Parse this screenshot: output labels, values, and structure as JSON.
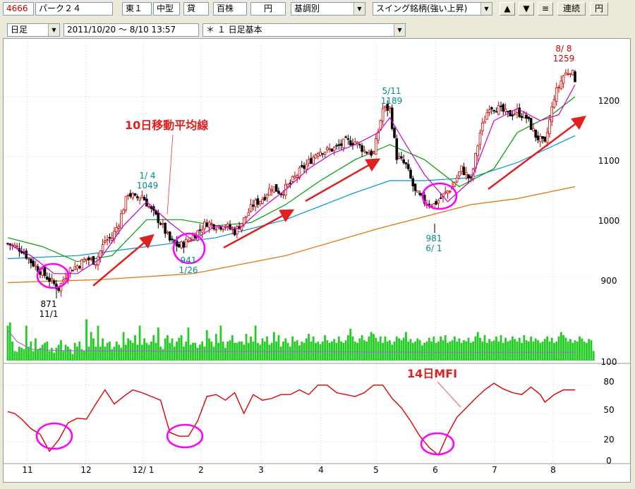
{
  "toolbar1": {
    "code": "4666",
    "name": "パーク２４",
    "market": "東１",
    "size": "中型",
    "lending": "貸",
    "unit": "百株",
    "currency_btn": "円",
    "select_mode": "基調別",
    "select_screen": "スイング銘柄(強い上昇)",
    "up_btn": "▲",
    "down_btn": "▼",
    "menu_btn": "≡",
    "continuous_btn": "連続",
    "yen_btn": "円"
  },
  "toolbar2": {
    "period": "日足",
    "range": "2011/10/20 ～  8/10 13:57",
    "template": "＊ １ 日足基本"
  },
  "chart_data": [
    {
      "type": "candlestick",
      "title": "",
      "price_axis": {
        "ticks": [
          900,
          1000,
          1100,
          1200
        ],
        "range": [
          870,
          1265
        ]
      },
      "x_months": [
        "11",
        "12",
        "12/ 1",
        "2",
        "3",
        "4",
        "5",
        "6",
        "7",
        "8"
      ],
      "annotations": [
        {
          "label_date": "1/ 4",
          "label_value": "1049"
        },
        {
          "label_date": "1/26",
          "label_value": "941"
        },
        {
          "label_date": "5/11",
          "label_value": "1189"
        },
        {
          "label_date": "6/ 1",
          "label_value": "981"
        },
        {
          "label_date": "8/ 8",
          "label_value": "1259"
        },
        {
          "label_date": "11/1",
          "label_value": "871"
        },
        {
          "text": "10日移動平均線"
        }
      ],
      "close_path": [
        [
          0,
          955
        ],
        [
          6,
          945
        ],
        [
          10,
          925
        ],
        [
          14,
          910
        ],
        [
          18,
          895
        ],
        [
          22,
          880
        ],
        [
          26,
          910
        ],
        [
          30,
          918
        ],
        [
          34,
          930
        ],
        [
          38,
          925
        ],
        [
          42,
          960
        ],
        [
          45,
          965
        ],
        [
          48,
          990
        ],
        [
          52,
          1040
        ],
        [
          55,
          1030
        ],
        [
          58,
          1035
        ],
        [
          62,
          1010
        ],
        [
          66,
          990
        ],
        [
          70,
          960
        ],
        [
          74,
          950
        ],
        [
          78,
          960
        ],
        [
          82,
          975
        ],
        [
          86,
          990
        ],
        [
          90,
          985
        ],
        [
          94,
          985
        ],
        [
          98,
          975
        ],
        [
          102,
          995
        ],
        [
          106,
          1020
        ],
        [
          110,
          1030
        ],
        [
          114,
          1050
        ],
        [
          118,
          1040
        ],
        [
          122,
          1055
        ],
        [
          126,
          1075
        ],
        [
          130,
          1090
        ],
        [
          134,
          1110
        ],
        [
          138,
          1110
        ],
        [
          142,
          1115
        ],
        [
          146,
          1125
        ],
        [
          150,
          1125
        ],
        [
          154,
          1110
        ],
        [
          158,
          1105
        ],
        [
          162,
          1180
        ],
        [
          165,
          1180
        ],
        [
          168,
          1100
        ],
        [
          172,
          1085
        ],
        [
          176,
          1040
        ],
        [
          180,
          1025
        ],
        [
          184,
          1020
        ],
        [
          188,
          1035
        ],
        [
          192,
          1050
        ],
        [
          196,
          1080
        ],
        [
          200,
          1060
        ],
        [
          204,
          1140
        ],
        [
          208,
          1185
        ],
        [
          212,
          1180
        ],
        [
          216,
          1170
        ],
        [
          220,
          1175
        ],
        [
          224,
          1165
        ],
        [
          228,
          1135
        ],
        [
          232,
          1120
        ],
        [
          236,
          1200
        ],
        [
          240,
          1235
        ],
        [
          243,
          1245
        ],
        [
          245,
          1230
        ]
      ],
      "ma10_path": [
        [
          0,
          955
        ],
        [
          10,
          935
        ],
        [
          20,
          905
        ],
        [
          30,
          905
        ],
        [
          40,
          930
        ],
        [
          50,
          985
        ],
        [
          60,
          1025
        ],
        [
          70,
          990
        ],
        [
          80,
          960
        ],
        [
          90,
          985
        ],
        [
          100,
          980
        ],
        [
          110,
          1015
        ],
        [
          120,
          1045
        ],
        [
          130,
          1080
        ],
        [
          140,
          1105
        ],
        [
          150,
          1120
        ],
        [
          160,
          1140
        ],
        [
          165,
          1165
        ],
        [
          172,
          1120
        ],
        [
          180,
          1070
        ],
        [
          190,
          1025
        ],
        [
          200,
          1060
        ],
        [
          210,
          1160
        ],
        [
          220,
          1180
        ],
        [
          230,
          1160
        ],
        [
          238,
          1170
        ],
        [
          245,
          1220
        ]
      ],
      "ma25_path": [
        [
          0,
          965
        ],
        [
          15,
          950
        ],
        [
          30,
          925
        ],
        [
          45,
          935
        ],
        [
          60,
          995
        ],
        [
          75,
          995
        ],
        [
          90,
          985
        ],
        [
          105,
          990
        ],
        [
          120,
          1020
        ],
        [
          135,
          1060
        ],
        [
          150,
          1095
        ],
        [
          165,
          1120
        ],
        [
          180,
          1095
        ],
        [
          195,
          1050
        ],
        [
          210,
          1080
        ],
        [
          220,
          1140
        ],
        [
          235,
          1170
        ],
        [
          245,
          1200
        ]
      ],
      "ma75_path": [
        [
          0,
          930
        ],
        [
          30,
          935
        ],
        [
          60,
          950
        ],
        [
          90,
          965
        ],
        [
          120,
          995
        ],
        [
          150,
          1040
        ],
        [
          165,
          1060
        ],
        [
          180,
          1060
        ],
        [
          200,
          1065
        ],
        [
          220,
          1090
        ],
        [
          245,
          1135
        ]
      ],
      "ma200_path": [
        [
          0,
          890
        ],
        [
          40,
          895
        ],
        [
          80,
          905
        ],
        [
          120,
          935
        ],
        [
          160,
          980
        ],
        [
          200,
          1020
        ],
        [
          220,
          1030
        ],
        [
          245,
          1050
        ]
      ]
    },
    {
      "type": "bar",
      "title": "",
      "ylabel_tick": "100",
      "values": [
        55,
        60,
        30,
        15,
        14,
        22,
        20,
        18,
        55,
        22,
        30,
        15,
        35,
        18,
        20,
        25,
        28,
        30,
        15,
        20,
        12,
        20,
        25,
        32,
        15,
        25,
        22,
        18,
        10,
        28,
        22,
        30,
        18,
        16,
        65,
        22,
        45,
        35,
        22,
        55,
        22,
        35,
        22,
        28,
        30,
        18,
        22,
        30,
        25,
        20,
        45,
        25,
        35,
        32,
        28,
        40,
        25,
        55,
        25,
        35,
        28,
        25,
        30,
        40,
        28,
        52,
        22,
        18,
        35,
        40,
        28,
        35,
        22,
        30,
        36,
        40,
        22,
        30,
        52,
        25,
        28,
        28,
        20,
        25,
        30,
        22,
        48,
        35,
        30,
        22,
        42,
        28,
        55,
        30,
        20,
        30,
        32,
        40,
        28,
        28,
        30,
        30,
        25,
        42,
        28,
        38,
        30,
        55,
        28,
        25,
        35,
        30,
        38,
        25,
        28,
        45,
        30,
        40,
        22,
        30,
        35,
        28,
        22,
        38,
        30,
        32,
        24,
        30,
        28,
        35,
        42,
        30,
        38,
        28,
        30,
        26,
        30,
        40,
        32,
        28,
        30,
        34,
        28,
        38,
        30,
        28,
        32,
        40,
        50,
        38,
        30,
        28,
        35,
        40,
        32,
        30,
        38,
        45,
        42,
        36,
        30,
        38,
        28,
        38,
        30,
        32,
        25,
        30,
        38,
        35,
        32,
        36,
        45,
        30,
        34,
        28,
        30,
        35,
        32,
        24,
        28,
        30,
        36,
        30,
        38,
        28,
        30,
        38,
        32,
        40,
        28,
        30,
        32,
        38,
        30,
        35,
        28,
        32,
        30,
        36,
        28,
        30,
        38,
        45,
        36,
        30,
        40,
        28,
        34,
        30,
        32,
        38,
        30,
        40,
        28,
        36,
        30,
        32,
        38,
        34,
        30,
        36,
        28,
        40,
        32,
        30,
        38,
        30,
        35,
        32,
        28,
        30,
        34,
        38,
        30,
        36,
        28,
        30,
        38,
        45,
        40,
        36,
        30,
        34,
        28,
        32,
        30,
        38,
        35,
        30,
        28,
        34,
        32,
        15
      ],
      "avg_path": [
        [
          0,
          48
        ],
        [
          4,
          30
        ],
        [
          10,
          18
        ],
        [
          20,
          16
        ],
        [
          40,
          15
        ],
        [
          60,
          15
        ],
        [
          100,
          14
        ],
        [
          140,
          14
        ],
        [
          180,
          13
        ],
        [
          220,
          13
        ],
        [
          245,
          13
        ]
      ]
    },
    {
      "type": "line",
      "title": "14日MFI",
      "y_ticks": [
        0,
        20,
        50,
        80
      ],
      "values": [
        [
          0,
          52
        ],
        [
          3,
          50
        ],
        [
          6,
          44
        ],
        [
          10,
          34
        ],
        [
          14,
          28
        ],
        [
          18,
          10
        ],
        [
          22,
          22
        ],
        [
          26,
          40
        ],
        [
          30,
          45
        ],
        [
          34,
          44
        ],
        [
          38,
          60
        ],
        [
          42,
          75
        ],
        [
          46,
          60
        ],
        [
          50,
          68
        ],
        [
          54,
          75
        ],
        [
          58,
          72
        ],
        [
          62,
          68
        ],
        [
          66,
          64
        ],
        [
          70,
          30
        ],
        [
          74,
          26
        ],
        [
          78,
          26
        ],
        [
          82,
          42
        ],
        [
          86,
          68
        ],
        [
          90,
          70
        ],
        [
          94,
          64
        ],
        [
          98,
          72
        ],
        [
          102,
          50
        ],
        [
          106,
          70
        ],
        [
          110,
          64
        ],
        [
          114,
          66
        ],
        [
          118,
          70
        ],
        [
          122,
          70
        ],
        [
          126,
          75
        ],
        [
          130,
          70
        ],
        [
          134,
          80
        ],
        [
          138,
          80
        ],
        [
          142,
          72
        ],
        [
          146,
          70
        ],
        [
          150,
          68
        ],
        [
          154,
          72
        ],
        [
          158,
          80
        ],
        [
          162,
          80
        ],
        [
          166,
          66
        ],
        [
          170,
          56
        ],
        [
          174,
          42
        ],
        [
          178,
          26
        ],
        [
          182,
          14
        ],
        [
          186,
          6
        ],
        [
          190,
          28
        ],
        [
          194,
          46
        ],
        [
          198,
          56
        ],
        [
          202,
          66
        ],
        [
          206,
          75
        ],
        [
          210,
          82
        ],
        [
          214,
          76
        ],
        [
          218,
          72
        ],
        [
          222,
          70
        ],
        [
          226,
          78
        ],
        [
          230,
          70
        ],
        [
          232,
          62
        ],
        [
          236,
          70
        ],
        [
          240,
          75
        ],
        [
          245,
          75
        ]
      ]
    }
  ],
  "colors": {
    "up": "#d00000",
    "down": "#000000",
    "ma10": "#c800c8",
    "ma25": "#00a000",
    "ma75": "#0096c8",
    "ma200": "#e07000",
    "vol": "#22cc22",
    "mfi": "#dd0000",
    "ring": "#ff00ff",
    "arrow": "#e02020",
    "cyanlabel": "#008c8c"
  }
}
